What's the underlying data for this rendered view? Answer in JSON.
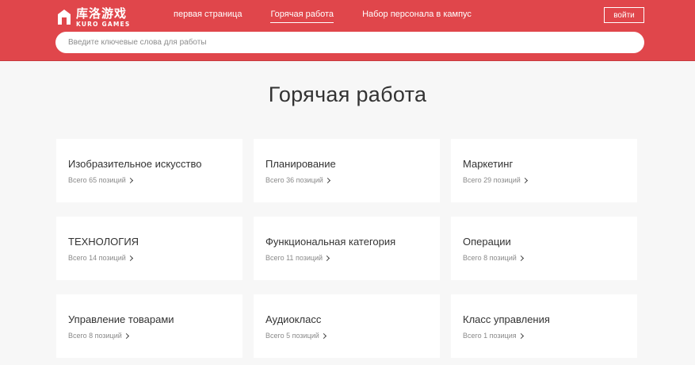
{
  "header": {
    "logo": {
      "cn": "库洛游戏",
      "en": "KURO GAMES"
    },
    "nav": [
      {
        "label": "первая страница"
      },
      {
        "label": "Горячая работа",
        "active": true
      },
      {
        "label": "Набор персонала в кампус"
      }
    ],
    "login_label": "войти",
    "search_placeholder": "Введите ключевые слова для работы"
  },
  "main": {
    "title": "Горячая работа",
    "categories": [
      {
        "title": "Изобразительное искусство",
        "count": "Всего 65 позиций"
      },
      {
        "title": "Планирование",
        "count": "Всего 36 позиций"
      },
      {
        "title": "Маркетинг",
        "count": "Всего 29 позиций"
      },
      {
        "title": "ТЕХНОЛОГИЯ",
        "count": "Всего 14 позиций"
      },
      {
        "title": "Функциональная категория",
        "count": "Всего 11 позиций"
      },
      {
        "title": "Операции",
        "count": "Всего 8 позиций"
      },
      {
        "title": "Управление товарами",
        "count": "Всего 8 позиций"
      },
      {
        "title": "Аудиокласс",
        "count": "Всего 5 позиций"
      },
      {
        "title": "Класс управления",
        "count": "Всего 1 позиция"
      }
    ]
  },
  "colors": {
    "brand": "#e0464b",
    "card_bg": "#ffffff",
    "page_bg": "#f7f7f7"
  },
  "icons": {
    "logo": "kuro-logo-icon",
    "chevron": "chevron-right-icon"
  }
}
